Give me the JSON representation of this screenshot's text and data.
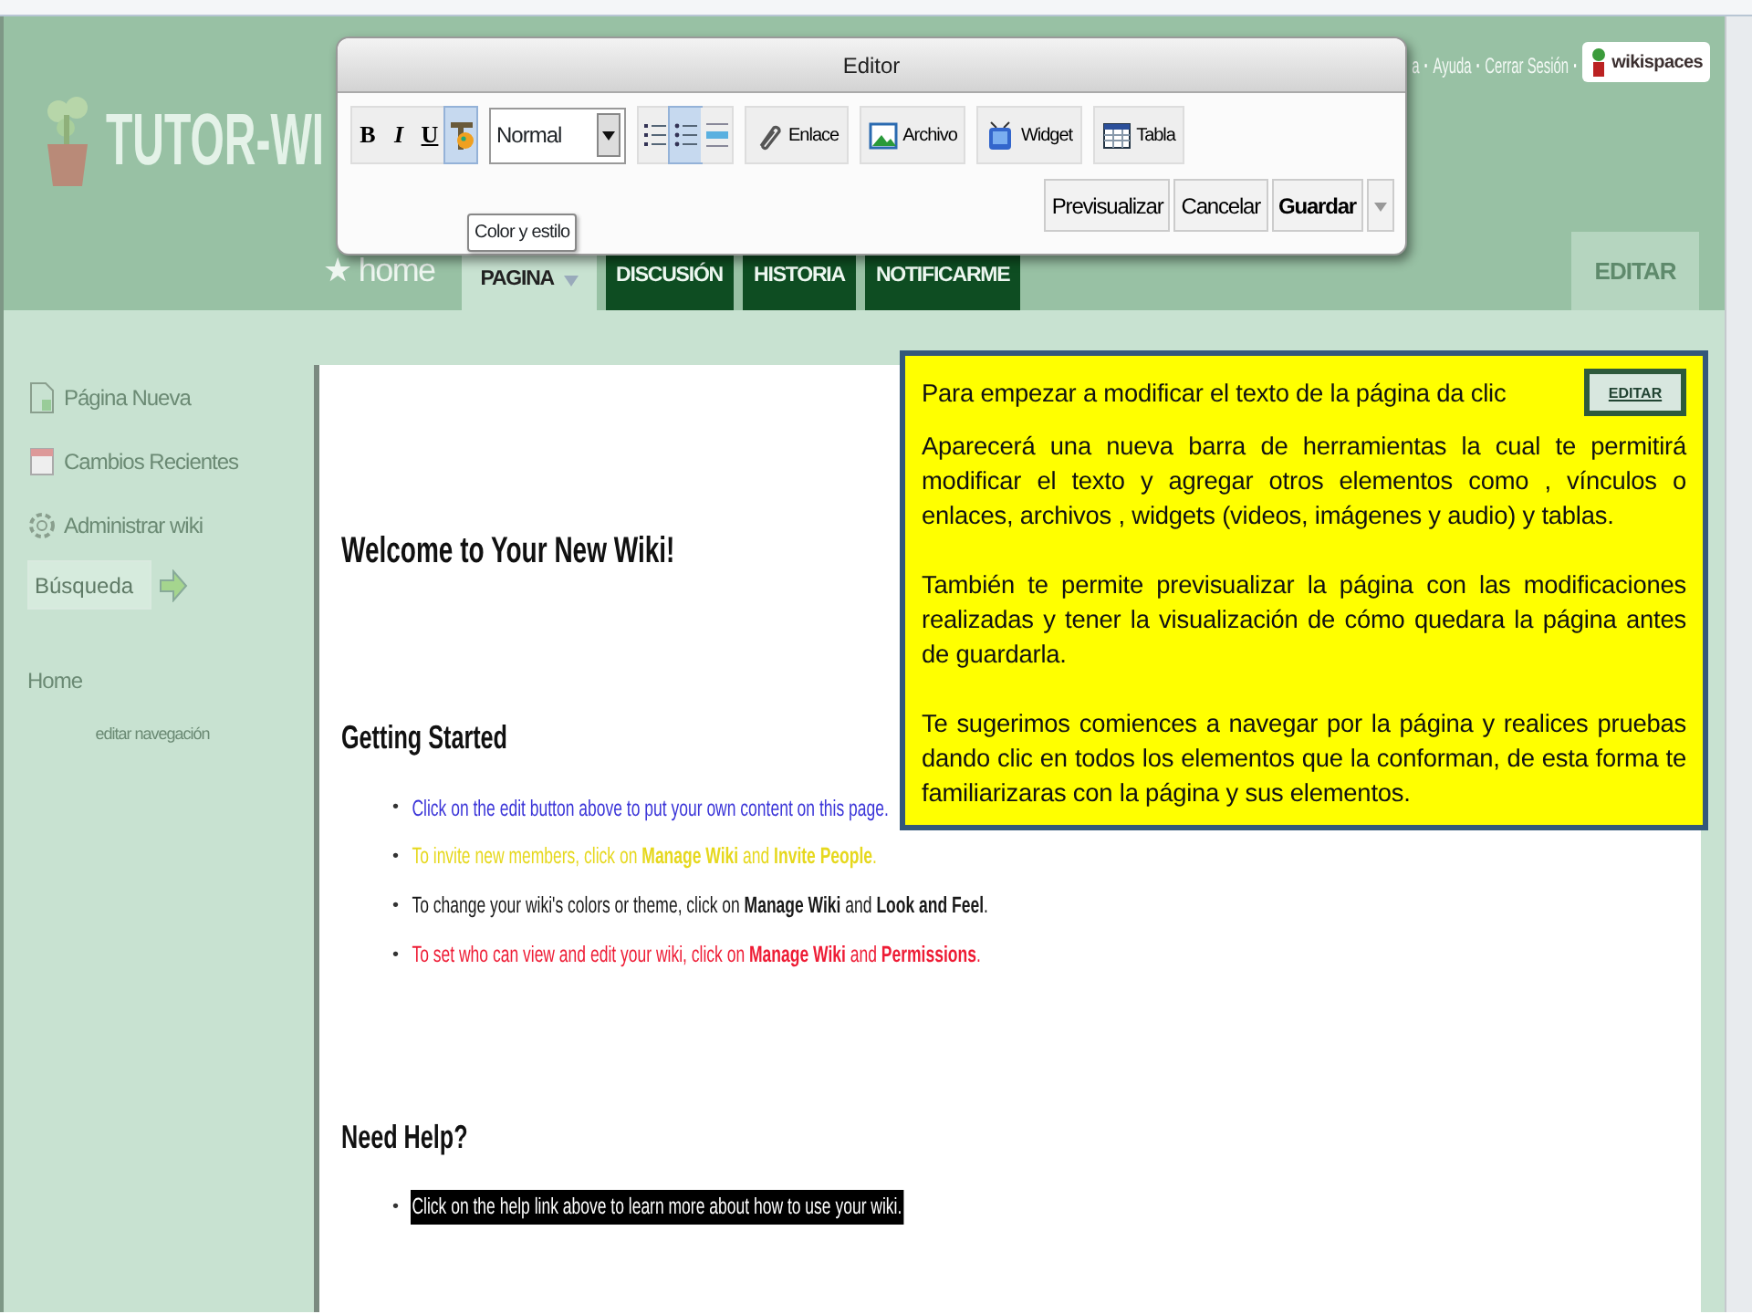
{
  "site": {
    "title": "TUTOR-WI"
  },
  "top_links": {
    "items": [
      "a",
      "Ayuda",
      "Cerrar Sesión"
    ],
    "separator": "·",
    "logo": "wikispaces"
  },
  "home_link": {
    "star": "★",
    "label": "home"
  },
  "tabs": [
    {
      "label": "PAGINA",
      "selected": true
    },
    {
      "label": "DISCUSIÓN",
      "selected": false
    },
    {
      "label": "HISTORIA",
      "selected": false
    },
    {
      "label": "NOTIFICARME",
      "selected": false
    }
  ],
  "edit_button": "EDITAR",
  "sidebar": {
    "items": [
      {
        "label": "Página Nueva",
        "kind": "page"
      },
      {
        "label": "Cambios Recientes",
        "kind": "calendar"
      },
      {
        "label": "Administrar wiki",
        "kind": "gear"
      }
    ],
    "search": {
      "placeholder": "Búsqueda"
    },
    "nav": [
      "Home"
    ],
    "edit_nav": "editar navegación"
  },
  "content": {
    "title": "Welcome to Your New Wiki!",
    "bullet": "•",
    "sections": [
      {
        "heading": "Getting Started",
        "items": [
          {
            "text": "Click on the edit button above to put your own content on this page.",
            "color": "#3b35d8",
            "highlighted": false
          },
          {
            "text": "To invite new members, click on **Manage Wiki** and **Invite People**.",
            "color": "#e6d81e",
            "highlighted": false
          },
          {
            "text": "To change your wiki's colors or theme, click on **Manage Wiki** and **Look and Feel**.",
            "color": "#1a1a1a",
            "highlighted": false
          },
          {
            "text": "To set who can view and edit your wiki, click on **Manage Wiki** and **Permissions**.",
            "color": "#ee1c35",
            "highlighted": false
          }
        ]
      },
      {
        "heading": "Need Help?",
        "items": [
          {
            "text": "Click on the help link above to learn more about how to use your wiki.",
            "color": "#000000",
            "highlighted": true
          }
        ]
      }
    ]
  },
  "editor": {
    "title": "Editor",
    "format_tools": [
      {
        "kind": "bold",
        "label": "B",
        "selected": false
      },
      {
        "kind": "italic",
        "label": "I",
        "selected": false
      },
      {
        "kind": "underline",
        "label": "U",
        "selected": false
      },
      {
        "kind": "color",
        "selected": true
      }
    ],
    "style_select": {
      "value": "Normal"
    },
    "list_tools": [
      {
        "kind": "numbered",
        "selected": false
      },
      {
        "kind": "bulleted",
        "selected": true
      },
      {
        "kind": "rule",
        "selected": false
      }
    ],
    "insert_tools": [
      {
        "kind": "link",
        "label": "Enlace"
      },
      {
        "kind": "file",
        "label": "Archivo"
      },
      {
        "kind": "widget",
        "label": "Widget"
      },
      {
        "kind": "table",
        "label": "Tabla"
      }
    ],
    "actions": [
      {
        "label": "Previsualizar",
        "bold": false
      },
      {
        "label": "Cancelar",
        "bold": false
      },
      {
        "label": "Guardar",
        "bold": true
      }
    ],
    "tooltip": "Color y estilo"
  },
  "callout": {
    "intro": "Para empezar a modificar el texto de la página da clic",
    "button": "EDITAR",
    "paragraphs": [
      "Aparecerá una nueva barra de herramientas la cual te permitirá modificar el texto y agregar otros elementos como , vínculos o enlaces, archivos , widgets (videos, imágenes y audio) y tablas.",
      "También te permite previsualizar la página con las modificaciones realizadas y tener la visualización de cómo quedara la página antes de guardarla.",
      "Te sugerimos comiences a navegar por la página y realices pruebas dando clic en todos los elementos que la conforman, de esta forma te familiarizaras con la página y sus elementos."
    ]
  }
}
